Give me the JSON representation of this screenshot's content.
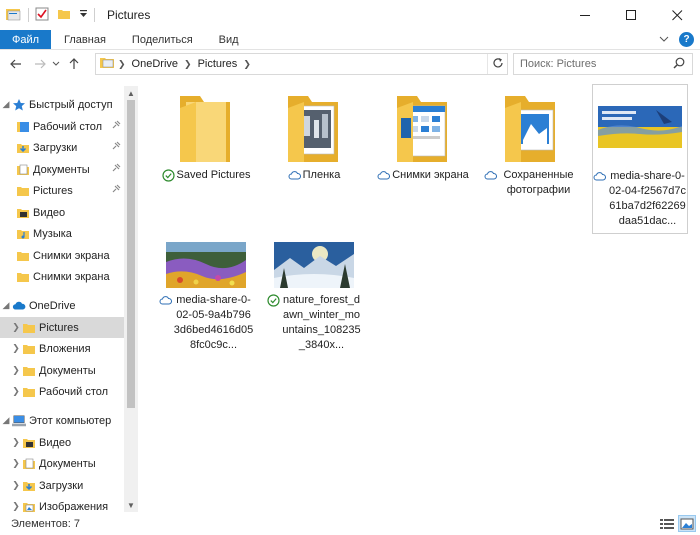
{
  "window": {
    "title": "Pictures"
  },
  "ribbon": {
    "tabs": [
      "Файл",
      "Главная",
      "Поделиться",
      "Вид"
    ]
  },
  "address": {
    "segments": [
      "OneDrive",
      "Pictures"
    ]
  },
  "search": {
    "placeholder": "Поиск: Pictures"
  },
  "sidebar": {
    "items": [
      {
        "label": "Быстрый доступ",
        "icon": "star-icon"
      },
      {
        "label": "Рабочий стол",
        "icon": "desktop-icon"
      },
      {
        "label": "Загрузки",
        "icon": "download-icon"
      },
      {
        "label": "Документы",
        "icon": "documents-icon"
      },
      {
        "label": "Pictures",
        "icon": "folder-icon"
      },
      {
        "label": "Видео",
        "icon": "video-icon"
      },
      {
        "label": "Музыка",
        "icon": "music-icon"
      },
      {
        "label": "Снимки экрана",
        "icon": "folder-icon"
      },
      {
        "label": "Снимки экрана",
        "icon": "folder-icon"
      },
      {
        "label": "OneDrive",
        "icon": "cloud-icon"
      },
      {
        "label": "Pictures",
        "icon": "folder-icon"
      },
      {
        "label": "Вложения",
        "icon": "folder-icon"
      },
      {
        "label": "Документы",
        "icon": "folder-icon"
      },
      {
        "label": "Рабочий стол",
        "icon": "folder-icon"
      },
      {
        "label": "Этот компьютер",
        "icon": "computer-icon"
      },
      {
        "label": "Видео",
        "icon": "video-icon"
      },
      {
        "label": "Документы",
        "icon": "documents-icon"
      },
      {
        "label": "Загрузки",
        "icon": "download-icon"
      },
      {
        "label": "Изображения",
        "icon": "pictures-icon"
      }
    ]
  },
  "files": [
    {
      "name": "Saved Pictures",
      "status": "synced",
      "kind": "folder-empty"
    },
    {
      "name": "Пленка",
      "status": "cloud",
      "kind": "folder-photo"
    },
    {
      "name": "Снимки экрана",
      "status": "cloud",
      "kind": "folder-screens"
    },
    {
      "name": "Сохраненные фотографии",
      "status": "cloud",
      "kind": "folder-saved"
    },
    {
      "name": "media-share-0-02-04-f2567d7c61ba7d2f62269daa51dac...",
      "status": "cloud",
      "kind": "image-flag"
    },
    {
      "name": "media-share-0-02-05-9a4b7963d6bed4616d058fc0c9c...",
      "status": "cloud",
      "kind": "image-flowers"
    },
    {
      "name": "nature_forest_dawn_winter_mountains_108235_3840x...",
      "status": "synced",
      "kind": "image-winter"
    }
  ],
  "statusbar": {
    "count_text": "Элементов: 7"
  },
  "colors": {
    "accent": "#1979ca",
    "synced": "#2e8b2e",
    "cloud": "#2f6fb5",
    "folder": "#f5c74c"
  }
}
